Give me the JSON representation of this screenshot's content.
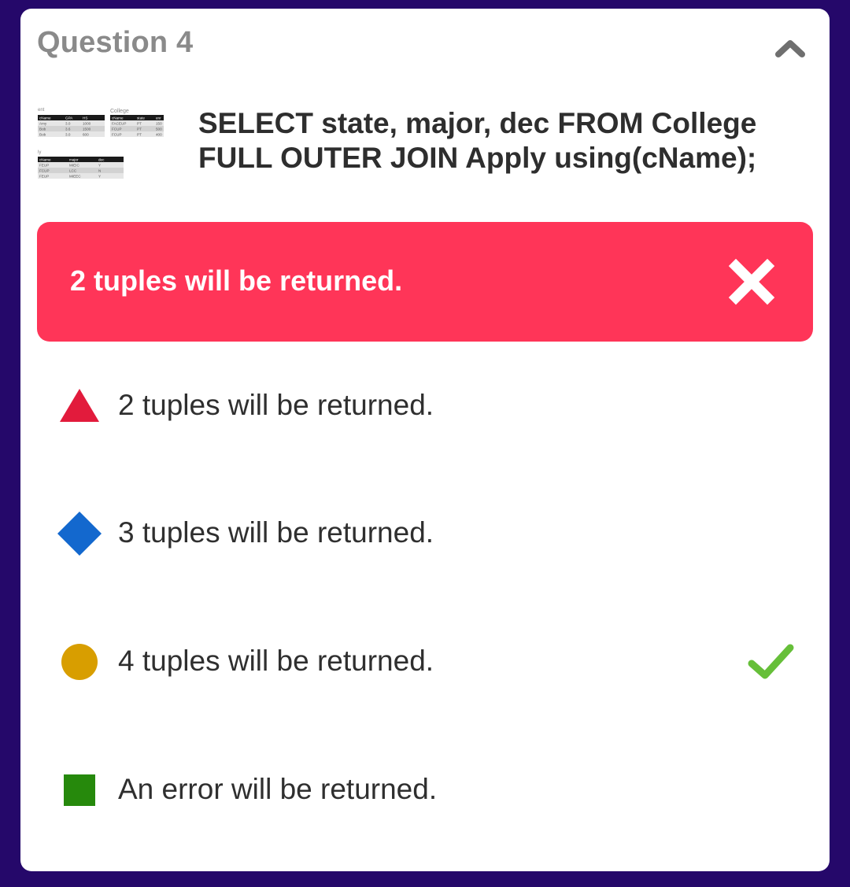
{
  "question": {
    "title": "Question 4",
    "text": "SELECT state, major, dec FROM College FULL OUTER JOIN Apply using(cName);"
  },
  "thumbnail": {
    "left_caption": "ent",
    "right_caption": "College",
    "bottom_caption": "ly",
    "student_table": {
      "headers": [
        "cName",
        "GPA",
        "HS"
      ],
      "rows": [
        [
          "Amy",
          "3.0",
          "1000"
        ],
        [
          "Bob",
          "3.6",
          "1500"
        ],
        [
          "Bob",
          "3.0",
          "600"
        ]
      ]
    },
    "college_table": {
      "headers": [
        "cName",
        "state",
        "enr"
      ],
      "rows": [
        [
          "FACEUP",
          "PT",
          "150"
        ],
        [
          "FCUP",
          "PT",
          "500"
        ],
        [
          "FCUP",
          "PT",
          "400"
        ]
      ]
    },
    "apply_table": {
      "headers": [
        "cName",
        "major",
        "dec"
      ],
      "rows": [
        [
          "FEUP",
          "MIEIC",
          "Y"
        ],
        [
          "FCUP",
          "LCC",
          "N"
        ],
        [
          "FEUP",
          "MIEEC",
          "Y"
        ]
      ]
    }
  },
  "selected_answer": {
    "label": "2 tuples will be returned.",
    "status": "incorrect",
    "color": "#ff3558"
  },
  "options": [
    {
      "label": "2 tuples will be returned.",
      "shape": "triangle",
      "color": "#e21b3c",
      "correct": false
    },
    {
      "label": "3 tuples will be returned.",
      "shape": "diamond",
      "color": "#1368ce",
      "correct": false
    },
    {
      "label": "4 tuples will be returned.",
      "shape": "circle",
      "color": "#d89e00",
      "correct": true
    },
    {
      "label": "An error will be returned.",
      "shape": "square",
      "color": "#26890c",
      "correct": false
    }
  ],
  "icons": {
    "collapse": "chevron-up-icon",
    "wrong": "close-icon",
    "right": "checkmark-icon"
  },
  "colors": {
    "background": "#25086a",
    "card": "#ffffff",
    "check": "#66bf39"
  }
}
